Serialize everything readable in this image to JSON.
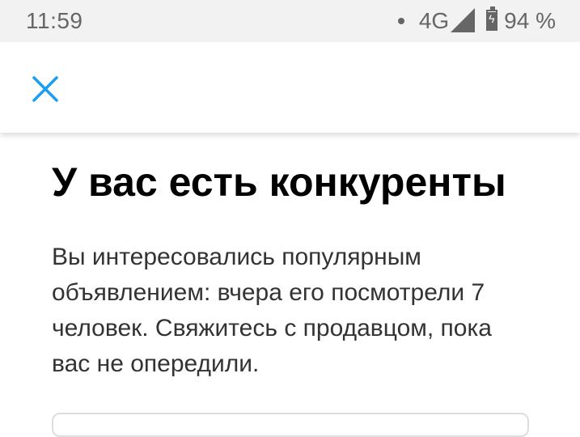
{
  "status_bar": {
    "time": "11:59",
    "network": "4G",
    "battery_text": "94 %",
    "battery_level_percent": 94
  },
  "toolbar": {
    "close_icon": "close-icon",
    "accent_color": "#1a9ff0"
  },
  "main": {
    "title": "У вас есть конкуренты",
    "body": "Вы интересовались популярным объявлением: вчера его посмотрели 7 человек. Свяжитесь с продавцом, пока вас не опередили."
  }
}
